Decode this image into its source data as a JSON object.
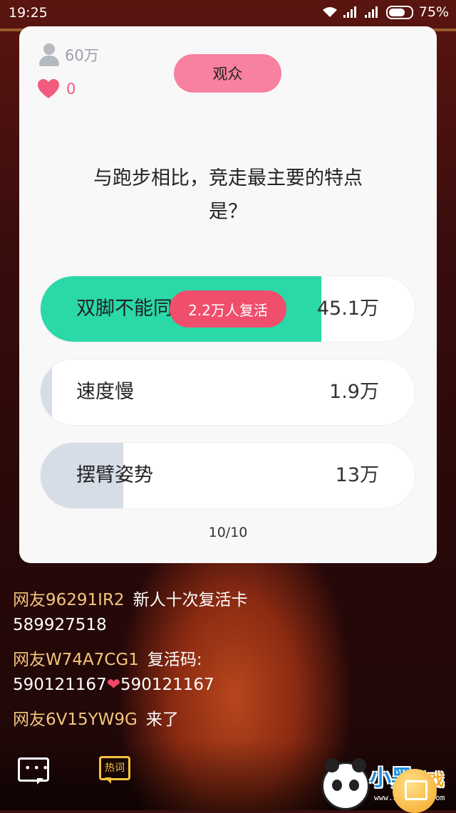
{
  "status_bar": {
    "time": "19:25",
    "battery": "75%"
  },
  "card": {
    "viewers": "60万",
    "likes": "0",
    "role_badge": "观众",
    "question_line1": "与跑步相比，竞走最主要的特点",
    "question_line2": "是？",
    "options": [
      {
        "label": "双脚不能同",
        "count": "45.1万",
        "fill_fraction": 0.75,
        "fill_color": "#2ad8a8"
      },
      {
        "label": "速度慢",
        "count": "1.9万",
        "fill_fraction": 0.03,
        "fill_color": "#d6dde7"
      },
      {
        "label": "摆臂姿势",
        "count": "13万",
        "fill_fraction": 0.22,
        "fill_color": "#d6dde7"
      }
    ],
    "revive_badge": "2.2万人复活",
    "progress": "10/10"
  },
  "chat": [
    {
      "user": "网友96291IR2",
      "text": "新人十次复活卡",
      "text2": "589927518"
    },
    {
      "user": "网友W74A7CG1",
      "text": "复活码:",
      "text2a": "590121167",
      "heart": "❤",
      "text2b": "590121167"
    },
    {
      "user": "网友6V15YW9G",
      "text": "来了"
    }
  ],
  "bottom": {
    "hot_words": "热词"
  },
  "logo": {
    "brand_main": "小黑",
    "brand_sub": "游戏",
    "url": "www.xiaohei.com"
  },
  "colors": {
    "accent_pink": "#f7819f",
    "correct_green": "#2ad8a8",
    "revive_red": "#ef4e6c",
    "chat_user": "#f3c67c"
  }
}
